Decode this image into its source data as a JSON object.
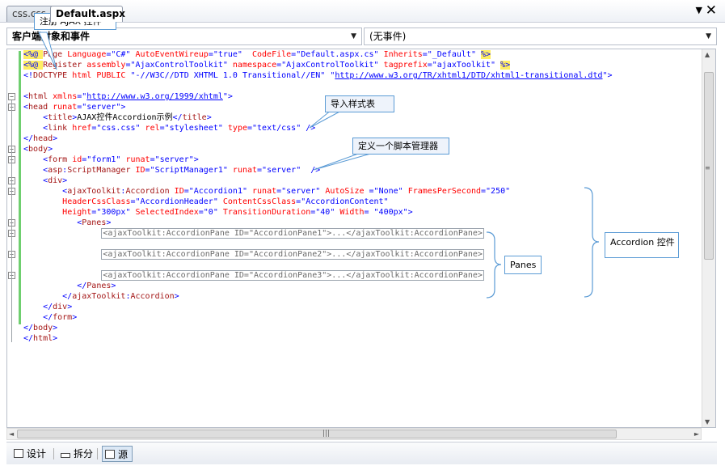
{
  "tabs": [
    {
      "label": "css.css"
    },
    {
      "label": "Default.aspx"
    }
  ],
  "tab_controls": {
    "menu_icon": "triangle-down-icon",
    "close_icon": "close-icon"
  },
  "dropdowns": {
    "client_objects": {
      "value": "客户端对象和事件"
    },
    "events": {
      "value": "(无事件)"
    }
  },
  "code_lines": [
    {
      "n": 1,
      "segments": [
        [
          "<%@ ",
          "dir"
        ],
        [
          "Page ",
          "maroon"
        ],
        [
          "Language",
          "red"
        ],
        [
          "=\"C#\" ",
          "blue"
        ],
        [
          "AutoEventWireup",
          "red"
        ],
        [
          "=\"true\"  ",
          "blue"
        ],
        [
          "CodeFile",
          "red"
        ],
        [
          "=\"Default.aspx.cs\" ",
          "blue"
        ],
        [
          "Inherits",
          "red"
        ],
        [
          "=\"_Default\" ",
          "blue"
        ],
        [
          "%>",
          "dir"
        ]
      ]
    },
    {
      "n": 2,
      "segments": [
        [
          "<%@ ",
          "dir"
        ],
        [
          "Register ",
          "maroon"
        ],
        [
          "assembly",
          "red"
        ],
        [
          "=\"AjaxControlToolkit\" ",
          "blue"
        ],
        [
          "namespace",
          "red"
        ],
        [
          "=\"AjaxControlToolkit\" ",
          "blue"
        ],
        [
          "tagprefix",
          "red"
        ],
        [
          "=\"ajaxToolkit\" ",
          "blue"
        ],
        [
          "%>",
          "dir"
        ]
      ]
    },
    {
      "n": 3,
      "segments": [
        [
          "<!",
          "blue"
        ],
        [
          "DOCTYPE ",
          "maroon"
        ],
        [
          "html ",
          "red"
        ],
        [
          "PUBLIC ",
          "red"
        ],
        [
          "\"-//W3C//DTD XHTML 1.0 Transitional//EN\" ",
          "blue"
        ],
        [
          "\"",
          "blue"
        ],
        [
          "http://www.w3.org/TR/xhtml1/DTD/xhtml1-transitional.dtd",
          "link"
        ],
        [
          "\">",
          "blue"
        ]
      ]
    },
    {
      "n": 4,
      "segments": []
    },
    {
      "n": 5,
      "segments": [
        [
          "<",
          "blue"
        ],
        [
          "html ",
          "maroon"
        ],
        [
          "xmlns",
          "red"
        ],
        [
          "=\"",
          "blue"
        ],
        [
          "http://www.w3.org/1999/xhtml",
          "link"
        ],
        [
          "\">",
          "blue"
        ]
      ]
    },
    {
      "n": 6,
      "segments": [
        [
          "<",
          "blue"
        ],
        [
          "head ",
          "maroon"
        ],
        [
          "runat",
          "red"
        ],
        [
          "=\"server\">",
          "blue"
        ]
      ]
    },
    {
      "n": 7,
      "segments": [
        [
          "    <",
          "blue"
        ],
        [
          "title",
          "maroon"
        ],
        [
          ">",
          "blue"
        ],
        [
          "AJAX控件Accordion示例",
          "black"
        ],
        [
          "</",
          "blue"
        ],
        [
          "title",
          "maroon"
        ],
        [
          ">",
          "blue"
        ]
      ]
    },
    {
      "n": 8,
      "segments": [
        [
          "    <",
          "blue"
        ],
        [
          "link ",
          "maroon"
        ],
        [
          "href",
          "red"
        ],
        [
          "=\"css.css\" ",
          "blue"
        ],
        [
          "rel",
          "red"
        ],
        [
          "=\"stylesheet\" ",
          "blue"
        ],
        [
          "type",
          "red"
        ],
        [
          "=\"text/css\" ",
          "blue"
        ],
        [
          "/>",
          "blue"
        ]
      ]
    },
    {
      "n": 9,
      "segments": [
        [
          "</",
          "blue"
        ],
        [
          "head",
          "maroon"
        ],
        [
          ">",
          "blue"
        ]
      ]
    },
    {
      "n": 10,
      "segments": [
        [
          "<",
          "blue"
        ],
        [
          "body",
          "maroon"
        ],
        [
          ">",
          "blue"
        ]
      ]
    },
    {
      "n": 11,
      "segments": [
        [
          "    <",
          "blue"
        ],
        [
          "form ",
          "maroon"
        ],
        [
          "id",
          "red"
        ],
        [
          "=\"form1\" ",
          "blue"
        ],
        [
          "runat",
          "red"
        ],
        [
          "=\"server\">",
          "blue"
        ]
      ]
    },
    {
      "n": 12,
      "segments": [
        [
          "    <",
          "blue"
        ],
        [
          "asp",
          "maroon"
        ],
        [
          ":",
          "blue"
        ],
        [
          "ScriptManager ",
          "maroon"
        ],
        [
          "ID",
          "red"
        ],
        [
          "=\"ScriptManager1\" ",
          "blue"
        ],
        [
          "runat",
          "red"
        ],
        [
          "=\"server\"  ",
          "blue"
        ],
        [
          "/>",
          "blue"
        ]
      ]
    },
    {
      "n": 13,
      "segments": [
        [
          "    <",
          "blue"
        ],
        [
          "div",
          "maroon"
        ],
        [
          ">",
          "blue"
        ]
      ]
    },
    {
      "n": 14,
      "segments": [
        [
          "        <",
          "blue"
        ],
        [
          "ajaxToolkit",
          "maroon"
        ],
        [
          ":",
          "blue"
        ],
        [
          "Accordion ",
          "maroon"
        ],
        [
          "ID",
          "red"
        ],
        [
          "=\"Accordion1\" ",
          "blue"
        ],
        [
          "runat",
          "red"
        ],
        [
          "=\"server\" ",
          "blue"
        ],
        [
          "AutoSize ",
          "red"
        ],
        [
          "=\"None\" ",
          "blue"
        ],
        [
          "FramesPerSecond",
          "red"
        ],
        [
          "=\"250\"",
          "blue"
        ]
      ]
    },
    {
      "n": 15,
      "segments": [
        [
          "        ",
          "black"
        ],
        [
          "HeaderCssClass",
          "red"
        ],
        [
          "=\"AccordionHeader\" ",
          "blue"
        ],
        [
          "ContentCssClass",
          "red"
        ],
        [
          "=\"AccordionContent\"",
          "blue"
        ]
      ]
    },
    {
      "n": 16,
      "segments": [
        [
          "        ",
          "black"
        ],
        [
          "Height",
          "red"
        ],
        [
          "=\"300px\" ",
          "blue"
        ],
        [
          "SelectedIndex",
          "red"
        ],
        [
          "=\"0\" ",
          "blue"
        ],
        [
          "TransitionDuration",
          "red"
        ],
        [
          "=\"40\" ",
          "blue"
        ],
        [
          "Width",
          "red"
        ],
        [
          "= \"400px\">",
          "blue"
        ]
      ]
    },
    {
      "n": 17,
      "segments": [
        [
          "           <",
          "blue"
        ],
        [
          "Panes",
          "maroon"
        ],
        [
          ">",
          "blue"
        ]
      ]
    },
    {
      "n": 18,
      "segments": [
        [
          "                ",
          "black"
        ],
        [
          "<ajaxToolkit:AccordionPane ID=\"AccordionPane1\">...</ajaxToolkit:AccordionPane>",
          "collapsed"
        ]
      ]
    },
    {
      "n": 19,
      "segments": []
    },
    {
      "n": 20,
      "segments": [
        [
          "                ",
          "black"
        ],
        [
          "<ajaxToolkit:AccordionPane ID=\"AccordionPane2\">...</ajaxToolkit:AccordionPane>",
          "collapsed"
        ]
      ]
    },
    {
      "n": 21,
      "segments": []
    },
    {
      "n": 22,
      "segments": [
        [
          "                ",
          "black"
        ],
        [
          "<ajaxToolkit:AccordionPane ID=\"AccordionPane3\">...</ajaxToolkit:AccordionPane>",
          "collapsed"
        ]
      ]
    },
    {
      "n": 23,
      "segments": [
        [
          "           </",
          "blue"
        ],
        [
          "Panes",
          "maroon"
        ],
        [
          ">",
          "blue"
        ]
      ]
    },
    {
      "n": 24,
      "segments": [
        [
          "        </",
          "blue"
        ],
        [
          "ajaxToolkit",
          "maroon"
        ],
        [
          ":",
          "blue"
        ],
        [
          "Accordion",
          "maroon"
        ],
        [
          ">",
          "blue"
        ]
      ]
    },
    {
      "n": 25,
      "segments": [
        [
          "    </",
          "blue"
        ],
        [
          "div",
          "maroon"
        ],
        [
          ">",
          "blue"
        ]
      ]
    },
    {
      "n": 26,
      "segments": [
        [
          "    </",
          "blue"
        ],
        [
          "form",
          "maroon"
        ],
        [
          ">",
          "blue"
        ]
      ]
    },
    {
      "n": 27,
      "segments": [
        [
          "</",
          "blue"
        ],
        [
          "body",
          "maroon"
        ],
        [
          ">",
          "blue"
        ]
      ]
    },
    {
      "n": 28,
      "segments": [
        [
          "</",
          "blue"
        ],
        [
          "html",
          "maroon"
        ],
        [
          ">",
          "blue"
        ]
      ]
    }
  ],
  "callouts": {
    "register": "注册 AJAX 控件",
    "stylesheet": "导入样式表",
    "script_manager": "定义一个脚本管理器",
    "panes": "Panes",
    "accordion": "Accordion 控件"
  },
  "view_buttons": [
    {
      "label": "设计",
      "icon": "design-view-icon"
    },
    {
      "label": "拆分",
      "icon": "split-view-icon"
    },
    {
      "label": "源",
      "icon": "source-view-icon"
    }
  ],
  "colors": {
    "keyword_blue": "#0000ff",
    "tag_maroon": "#a31515",
    "attr_red": "#ff0000",
    "directive_highlight": "#ffee62",
    "callout_border": "#5b9bd5"
  }
}
